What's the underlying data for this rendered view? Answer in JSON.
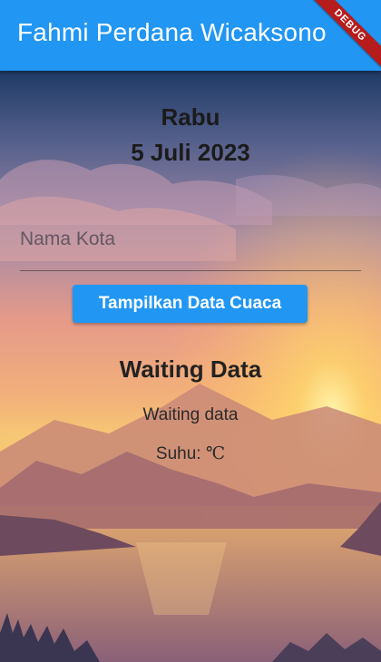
{
  "app_bar": {
    "title": "Fahmi Perdana Wicaksono",
    "debug_label": "DEBUG"
  },
  "date": {
    "day": "Rabu",
    "full": "5 Juli 2023"
  },
  "city_input": {
    "value": "",
    "placeholder": "Nama Kota"
  },
  "button": {
    "label": "Tampilkan Data Cuaca"
  },
  "weather": {
    "title": "Waiting Data",
    "description": "Waiting data",
    "temp_label": "Suhu:",
    "temp_value": "",
    "unit": "℃"
  },
  "colors": {
    "accent": "#2196f3",
    "debug": "#b71c1c"
  }
}
